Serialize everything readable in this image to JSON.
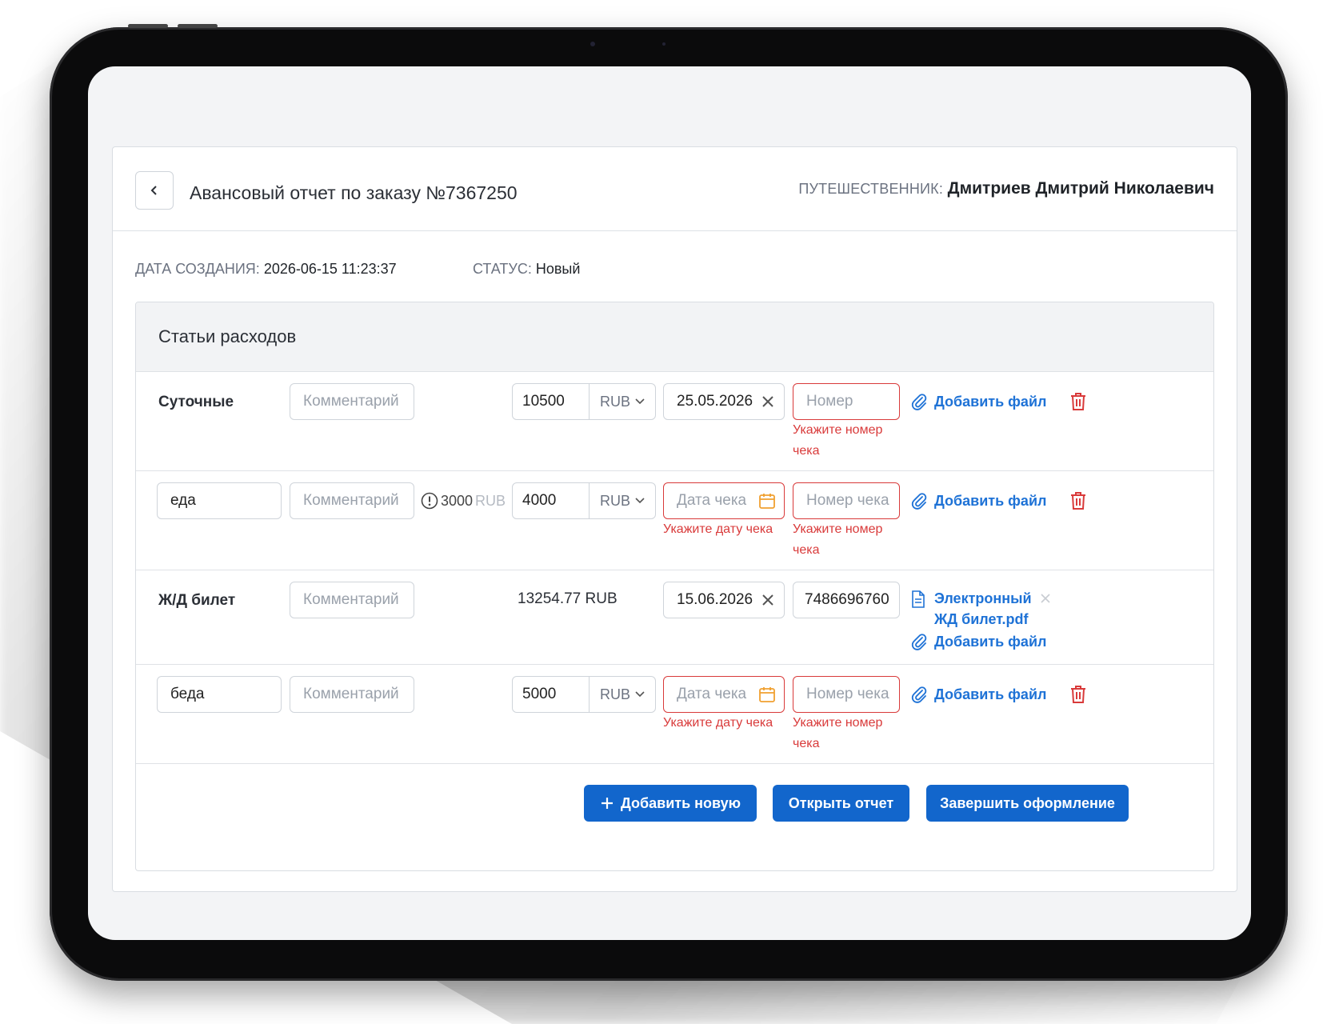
{
  "header": {
    "title": "Авансовый отчет по заказу №7367250",
    "traveler_label": "ПУТЕШЕСТВЕННИК:",
    "traveler_name": "Дмитриев Дмитрий Николаевич"
  },
  "meta": {
    "created_label": "ДАТА СОЗДАНИЯ:",
    "created_value": "2026-06-15 11:23:37",
    "status_label": "СТАТУС:",
    "status_value": "Новый"
  },
  "expenses": {
    "title": "Статьи расходов",
    "comment_placeholder": "Комментарий",
    "date_placeholder": "Дата чека",
    "receipt_placeholder": "Номер чека",
    "receipt_placeholder_short": "Номер",
    "add_file_label": "Добавить файл",
    "error_receipt": "Укажите номер чека",
    "error_date": "Укажите дату чека",
    "rows": [
      {
        "name": "Суточные",
        "amount": "10500",
        "currency": "RUB",
        "date": "25.05.2026"
      },
      {
        "name": "еда",
        "limit_value": "3000",
        "limit_currency": "RUB",
        "amount": "4000",
        "currency": "RUB"
      },
      {
        "name": "Ж/Д билет",
        "fixed_amount": "13254.77 RUB",
        "date": "15.06.2026",
        "receipt": "7486696760",
        "file_name": "Электронный ЖД билет.pdf"
      },
      {
        "name": "беда",
        "amount": "5000",
        "currency": "RUB"
      }
    ]
  },
  "actions": {
    "add_new": "Добавить новую",
    "open_report": "Открыть отчет",
    "finish": "Завершить оформление"
  },
  "colors": {
    "accent": "#1266cc",
    "link": "#1e72d6",
    "error": "#d93a3a",
    "warning_icon": "#f0a030"
  }
}
